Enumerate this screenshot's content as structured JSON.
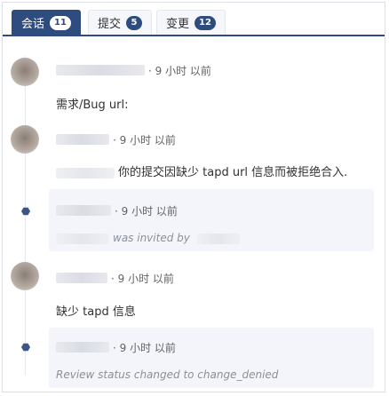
{
  "tabs": [
    {
      "label": "会话",
      "count": "11",
      "active": true
    },
    {
      "label": "提交",
      "count": "5",
      "active": false
    },
    {
      "label": "变更",
      "count": "12",
      "active": false
    }
  ],
  "timeline": [
    {
      "kind": "comment",
      "time": "· 9 小时 以前",
      "text": "需求/Bug url:"
    },
    {
      "kind": "comment",
      "time": "· 9 小时 以前",
      "text": "你的提交因缺少 tapd url 信息而被拒绝合入."
    },
    {
      "kind": "event",
      "time": "· 9 小时 以前",
      "text": "was invited by"
    },
    {
      "kind": "comment",
      "time": "· 9 小时 以前",
      "text": "缺少 tapd 信息"
    },
    {
      "kind": "event",
      "time": "· 9 小时 以前",
      "text": "Review status changed to change_denied"
    }
  ],
  "colors": {
    "accent": "#2f4c7e",
    "event_bg": "#f3f5fa",
    "dot": "#3d5487"
  },
  "icons": {
    "event_dot": "hexagon-dot-icon"
  }
}
